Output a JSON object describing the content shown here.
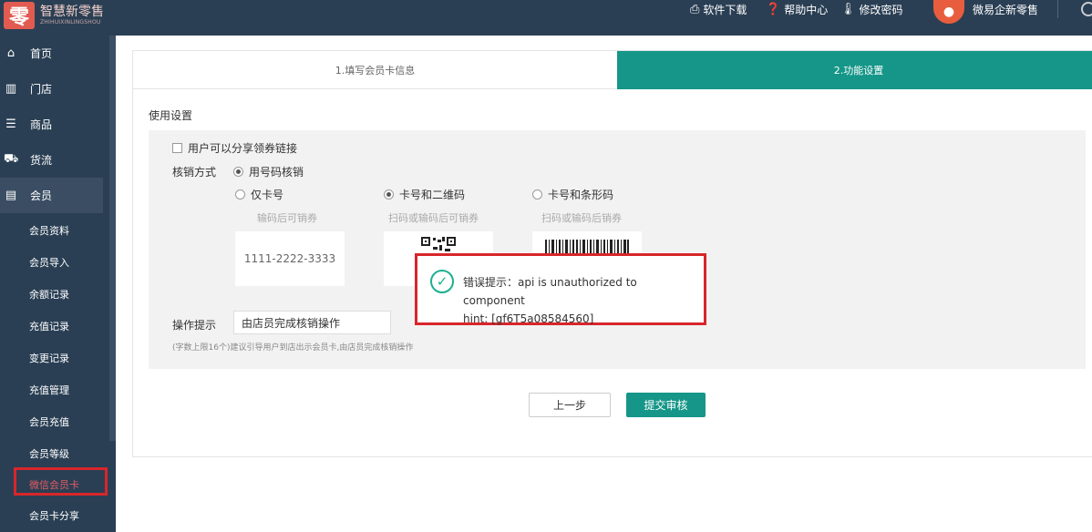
{
  "header": {
    "logo_mark": "零",
    "logo_cn": "智慧新零售",
    "logo_en": "ZHIHUIXINLINGSHOU",
    "download": "软件下载",
    "help": "帮助中心",
    "change_password": "修改密码",
    "username": "微易企新零售"
  },
  "sidebar": {
    "main": [
      {
        "label": "首页",
        "icon": "home-icon"
      },
      {
        "label": "门店",
        "icon": "building-icon"
      },
      {
        "label": "商品",
        "icon": "list-icon"
      },
      {
        "label": "货流",
        "icon": "truck-icon"
      },
      {
        "label": "会员",
        "icon": "id-card-icon"
      }
    ],
    "sub": [
      "会员资料",
      "会员导入",
      "余额记录",
      "充值记录",
      "变更记录",
      "充值管理",
      "会员充值",
      "会员等级",
      "微信会员卡",
      "会员卡分享"
    ]
  },
  "steps": [
    "1.填写会员卡信息",
    "2.功能设置"
  ],
  "section_title": "使用设置",
  "settings": {
    "share_label": "用户可以分享领券链接",
    "verify_label": "核销方式",
    "verify_option": "用号码核销",
    "options": [
      {
        "label": "仅卡号",
        "hint": "输码后可销券",
        "checked": false
      },
      {
        "label": "卡号和二维码",
        "hint": "扫码或输码后可销券",
        "checked": true
      },
      {
        "label": "卡号和条形码",
        "hint": "扫码或输码后销券",
        "checked": false
      }
    ],
    "card_number": "1111-2222-3333",
    "tip_label": "操作提示",
    "tip_value": "由店员完成核销操作",
    "tip_note": "(字数上限16个)建议引导用户到店出示会员卡,由店员完成核销操作"
  },
  "buttons": {
    "prev": "上一步",
    "submit": "提交审核"
  },
  "toast": {
    "line1": "错误提示：api is unauthorized to component",
    "line2": "hint: [gf6T5a08584560]"
  },
  "colors": {
    "sidebar": "#2a3f54",
    "accent": "#159688",
    "highlight_border": "#d8262b"
  }
}
